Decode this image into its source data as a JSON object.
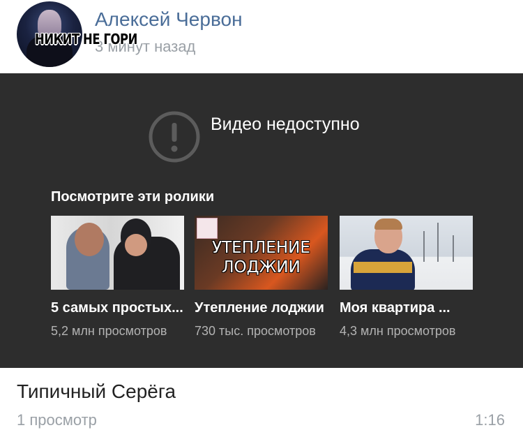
{
  "post": {
    "author_name": "Алексей Червон",
    "time_ago": "3 минут назад",
    "avatar_overlay_text": "НИКИТ НЕ ГОРИ"
  },
  "player": {
    "unavailable_text": "Видео недоступно",
    "suggestions_title": "Посмотрите эти ролики",
    "suggestions": [
      {
        "title": "5 самых простых...",
        "views": "5,2 млн просмотров"
      },
      {
        "title": "Утепление лоджии",
        "views": "730 тыс. просмотров",
        "thumb_caption_line1": "УТЕПЛЕНИЕ",
        "thumb_caption_line2": "ЛОДЖИИ"
      },
      {
        "title": "Моя квартира ...",
        "views": "4,3 млн просмотров"
      }
    ]
  },
  "video": {
    "title": "Типичный Серёга",
    "views": "1 просмотр",
    "duration": "1:16"
  },
  "colors": {
    "author_link": "#4a6d98",
    "player_bg": "#2d2d2d",
    "muted_text": "#9aa0a6"
  },
  "icons": {
    "warning": "exclamation-circle-icon"
  }
}
